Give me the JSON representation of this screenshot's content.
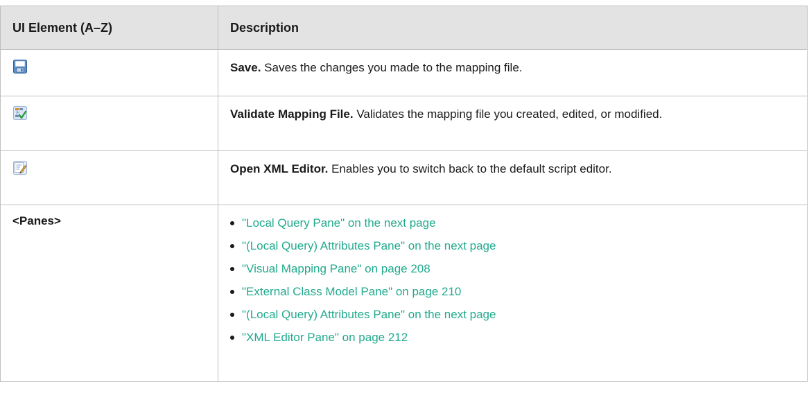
{
  "header": {
    "col_element": "UI Element (A–Z)",
    "col_description": "Description"
  },
  "rows": [
    {
      "icon": "save-icon",
      "title": "Save.",
      "text": " Saves the changes you made to the mapping file."
    },
    {
      "icon": "validate-mapping-icon",
      "title": "Validate Mapping File.",
      "text": " Validates the mapping file you created, edited, or modified."
    },
    {
      "icon": "open-xml-editor-icon",
      "title": "Open XML Editor.",
      "text": " Enables you to switch back to the default script editor."
    },
    {
      "element": "<Panes>",
      "links": [
        "\"Local Query Pane\" on the next page",
        "\"(Local Query) Attributes Pane\" on the next page",
        "\"Visual Mapping Pane\" on page 208",
        "\"External Class Model Pane\" on page 210",
        "\"(Local Query) Attributes Pane\" on the next page",
        "\"XML Editor Pane\" on page 212"
      ]
    }
  ],
  "colors": {
    "header_bg": "#e3e3e3",
    "border": "#bfbfbf",
    "link": "#22aa8e"
  }
}
